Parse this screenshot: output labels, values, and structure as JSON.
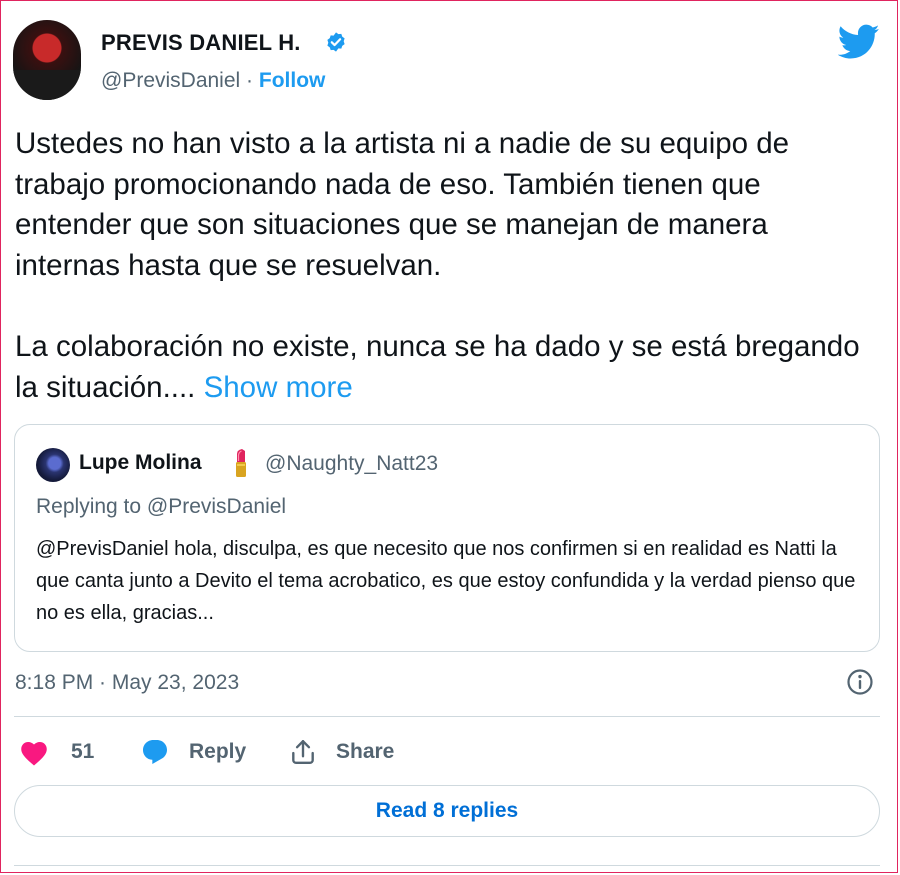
{
  "author": {
    "display_name": "PREVIS DANIEL H.",
    "handle": "@PrevisDaniel",
    "separator": "·",
    "follow_label": "Follow",
    "verified": true
  },
  "tweet": {
    "paragraph_1": "Ustedes no han visto a la artista ni a nadie de su equipo de trabajo promocionando nada de eso. También tienen que entender que son situaciones que se manejan de manera internas hasta que se resuelvan.",
    "paragraph_2": "La colaboración no existe, nunca se ha dado y se está bregando la situación....",
    "show_more_label": "Show more",
    "timestamp": "8:18 PM · May 23, 2023"
  },
  "quoted_tweet": {
    "display_name": "Lupe Molina",
    "name_emoji": "lipstick-icon",
    "handle": "@Naughty_Natt23",
    "replying_to": "Replying to @PrevisDaniel",
    "text": "@PrevisDaniel hola, disculpa, es que necesito que nos confirmen si en realidad es Natti la que canta junto a Devito el tema acrobatico, es que estoy confundida y la verdad pienso que no es ella, gracias..."
  },
  "actions": {
    "like_count": "51",
    "reply_label": "Reply",
    "share_label": "Share"
  },
  "read_replies_label": "Read 8 replies",
  "colors": {
    "accent": "#1d9bf0",
    "like": "#f91880",
    "text": "#0f1419",
    "secondary": "#536471",
    "border": "#cfd9de",
    "frame": "#e0245e"
  }
}
